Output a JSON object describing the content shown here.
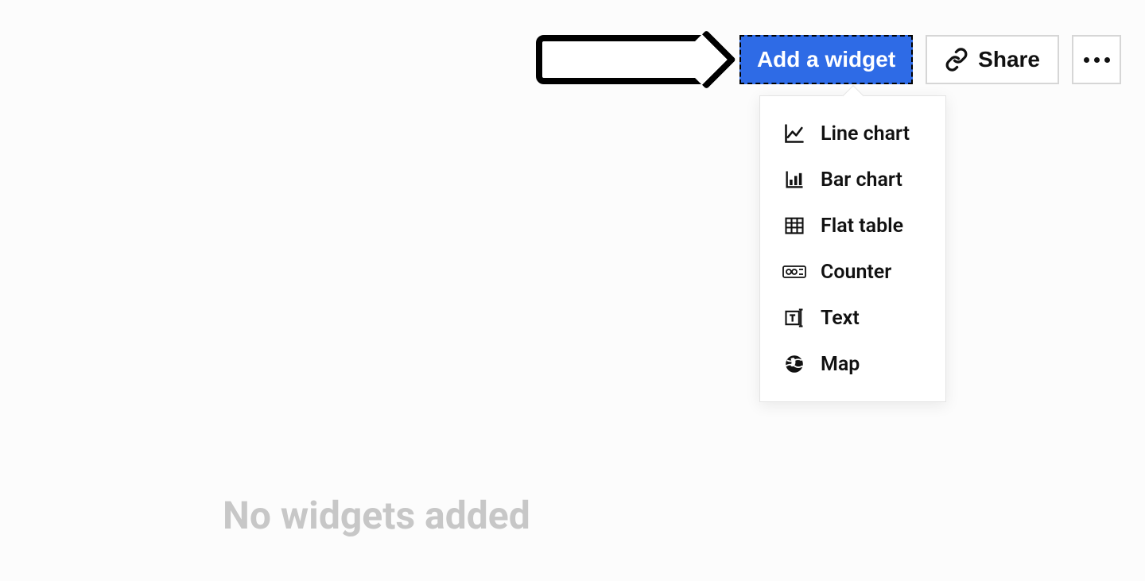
{
  "toolbar": {
    "add_widget_label": "Add a widget",
    "share_label": "Share"
  },
  "widget_menu": {
    "items": [
      {
        "label": "Line chart",
        "icon": "line-chart-icon"
      },
      {
        "label": "Bar chart",
        "icon": "bar-chart-icon"
      },
      {
        "label": "Flat table",
        "icon": "table-icon"
      },
      {
        "label": "Counter",
        "icon": "counter-icon"
      },
      {
        "label": "Text",
        "icon": "text-icon"
      },
      {
        "label": "Map",
        "icon": "globe-icon"
      }
    ]
  },
  "empty_state": {
    "message": "No widgets added"
  }
}
